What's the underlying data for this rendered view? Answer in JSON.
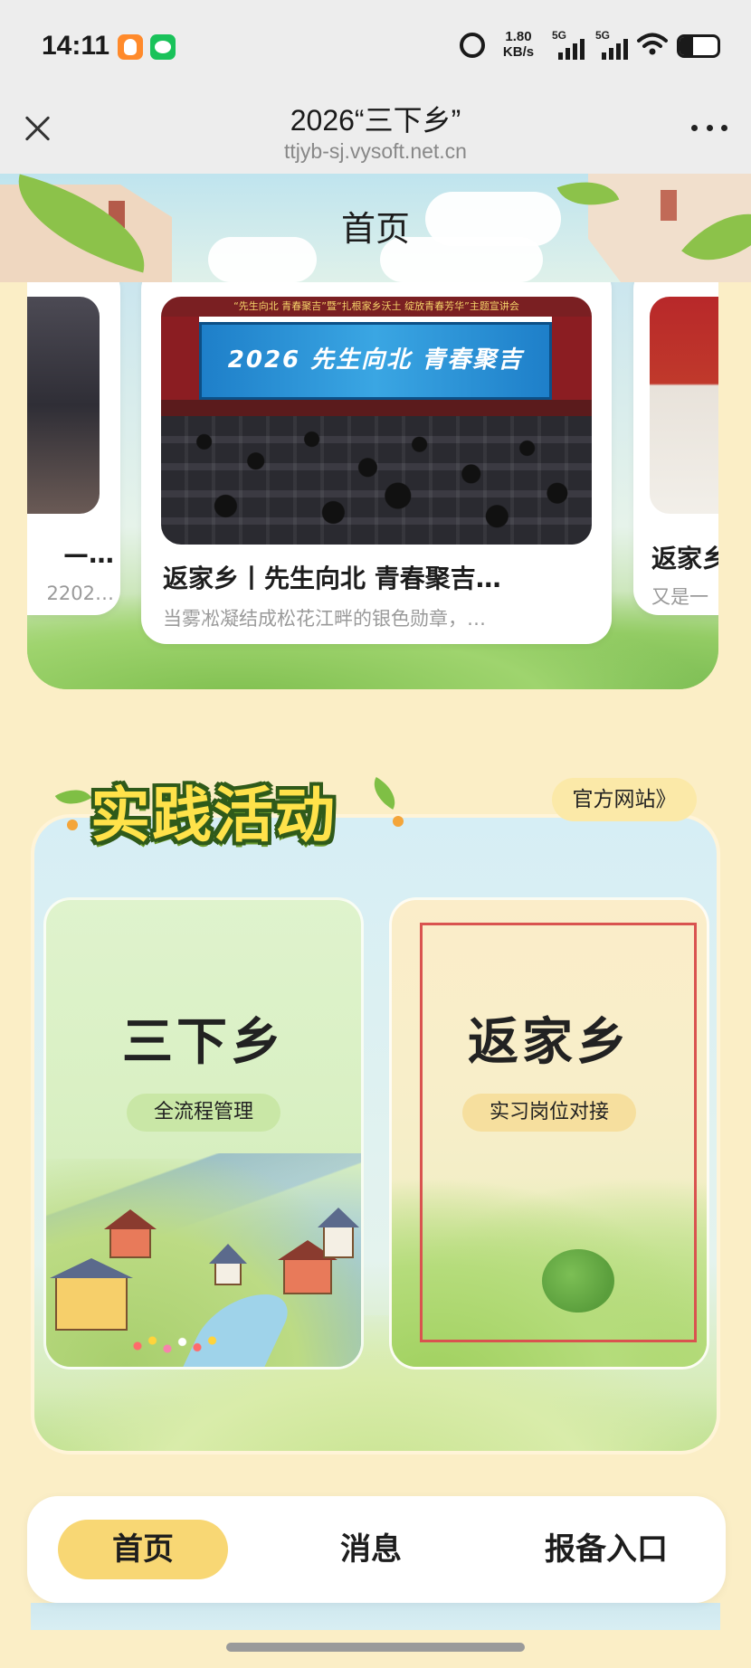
{
  "status_bar": {
    "time": "14:11",
    "network_speed": "1.80",
    "network_speed_unit": "KB/s",
    "signal1_label": "5G",
    "signal2_label": "5G",
    "battery_level": 0.35,
    "icons": [
      "qq-notification-icon",
      "wechat-notification-icon",
      "alarm-icon",
      "wifi-icon",
      "battery-icon"
    ]
  },
  "browser": {
    "title": "2026“三下乡”",
    "url": "ttjyb-sj.vysoft.net.cn",
    "close_icon": "close-icon",
    "more_icon": "more-icon"
  },
  "header": {
    "title": "首页"
  },
  "news": {
    "cards": [
      {
        "title": "返家乡丨先生向北 青春聚吉…",
        "desc": "当雾凇凝结成松花江畔的银色勋章，…",
        "photo_banner": "“先生向北 青春聚吉”暨“扎根家乡沃土 绽放青春芳华”主题宣讲会",
        "photo_screen": "2026 先生向北 青春聚吉"
      },
      {
        "title": "—…",
        "desc": "2202…"
      },
      {
        "title": "返家乡",
        "desc": "又是一"
      }
    ]
  },
  "practice": {
    "heading": "实践活动",
    "official_site": "官方网站》",
    "activities": [
      {
        "title": "三下乡",
        "tag": "全流程管理"
      },
      {
        "title": "返家乡",
        "tag": "实习岗位对接"
      }
    ]
  },
  "bottom_nav": {
    "items": [
      {
        "label": "首页",
        "active": true
      },
      {
        "label": "消息",
        "active": false
      },
      {
        "label": "报备入口",
        "active": false
      }
    ]
  },
  "colors": {
    "page_bg": "#fbeec6",
    "active_tab": "#f8d774",
    "heading_yellow": "#ffe24a",
    "highlight_border": "#d9534f"
  }
}
